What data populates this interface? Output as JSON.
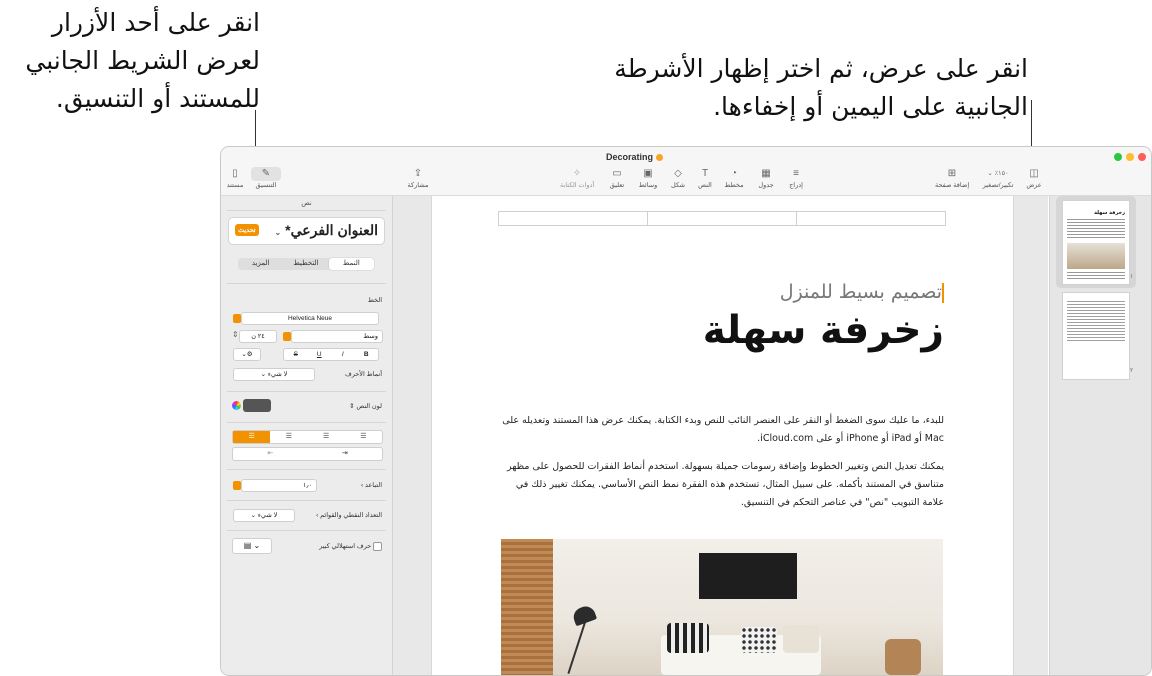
{
  "callouts": {
    "left": [
      "انقر على أحد الأزرار",
      "لعرض الشريط الجانبي",
      "للمستند أو التنسيق."
    ],
    "right": [
      "انقر على عرض، ثم اختر إظهار الأشرطة",
      "الجانبية على اليمين أو إخفاءها."
    ]
  },
  "window": {
    "title": "Decorating"
  },
  "toolbar": {
    "document": "مستند",
    "format": "التنسيق",
    "share": "مشاركة",
    "writing_tools": "أدوات الكتابة",
    "comment": "تعليق",
    "media": "وسائط",
    "shape": "شكل",
    "text": "النص",
    "chart": "مخطط",
    "table": "جدول",
    "insert": "إدراج",
    "add_page": "إضافة صفحة",
    "zoom": "تكبير/تصغير",
    "zoom_value": "٪١٥٠",
    "view": "عرض"
  },
  "sidebar": {
    "header": "نص",
    "style_name": "العنوان الفرعي*",
    "update_label": "تحديث",
    "tabs": [
      "النمط",
      "التخطيط",
      "المزيد"
    ],
    "font_section": "الخط",
    "font_name": "Helvetica Neue",
    "font_weight": "وسط",
    "font_size": "٢٤ ن",
    "bold": "B",
    "italic": "I",
    "underline": "U",
    "strike": "S",
    "char_styles_label": "أنماط الأحرف",
    "char_styles_value": "لا شيء",
    "text_color_label": "لون النص",
    "spacing_label": "التباعد",
    "spacing_value": "١٫٠",
    "bullets_label": "التعداد النقطي والقوائم",
    "bullets_value": "لا شيء",
    "dropcap_label": "حرف استهلالي كبير"
  },
  "page": {
    "subtitle": "تصميم بسيط للمنزل",
    "title": "زخرفة سهلة",
    "paragraph1": "للبدء، ما عليك سوى الضغط أو النقر على العنصر النائب للنص وبدء الكتابة. يمكنك عرض هذا المستند وتعديله على Mac أو iPad أو iPhone أو على iCloud.com.",
    "paragraph2": "يمكنك تعديل النص وتغيير الخطوط وإضافة رسومات جميلة بسهولة. استخدم أنماط الفقرات للحصول على مظهر متناسق في المستند بأكمله. على سبيل المثال، تستخدم هذه الفقرة نمط النص الأساسي. يمكنك تغيير ذلك في علامة التبويب \"نص\" في عناصر التحكم في التنسيق."
  },
  "thumbnails": {
    "page1_number": "١",
    "page2_number": "٢",
    "page1_title": "زخرفة سهلة"
  },
  "colors": {
    "accent": "#f39200",
    "close": "#fe5f57",
    "minimize": "#febc2e",
    "zoom": "#28c840"
  }
}
